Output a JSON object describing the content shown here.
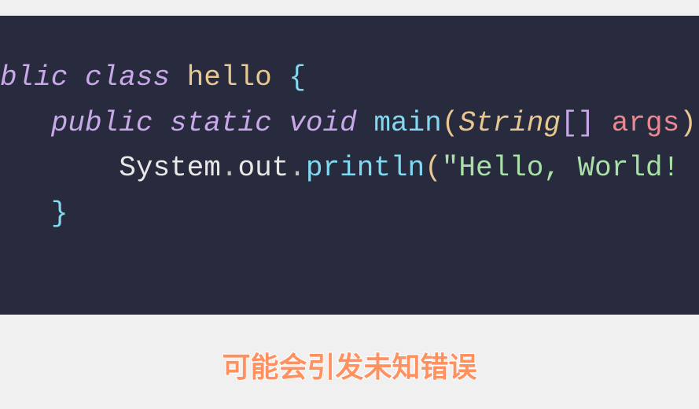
{
  "code": {
    "line1": {
      "modifier": "blic",
      "classKw": "class",
      "className": "hello",
      "openBrace": "{"
    },
    "line2": {
      "indent": "   ",
      "public": "public",
      "static": "static",
      "void": "void",
      "methodName": "main",
      "openParen": "(",
      "paramType": "String",
      "openBracket": "[",
      "closeBracket": "]",
      "paramName": "args",
      "closeParen": ")"
    },
    "line3": {
      "indent": "       ",
      "object": "System",
      "dot1": ".",
      "property": "out",
      "dot2": ".",
      "method": "println",
      "openParen": "(",
      "string": "\"Hello, World!",
      "closeParen": ""
    },
    "line4": {
      "indent": "   ",
      "closeBrace": "}"
    }
  },
  "caption": "可能会引发未知错误"
}
